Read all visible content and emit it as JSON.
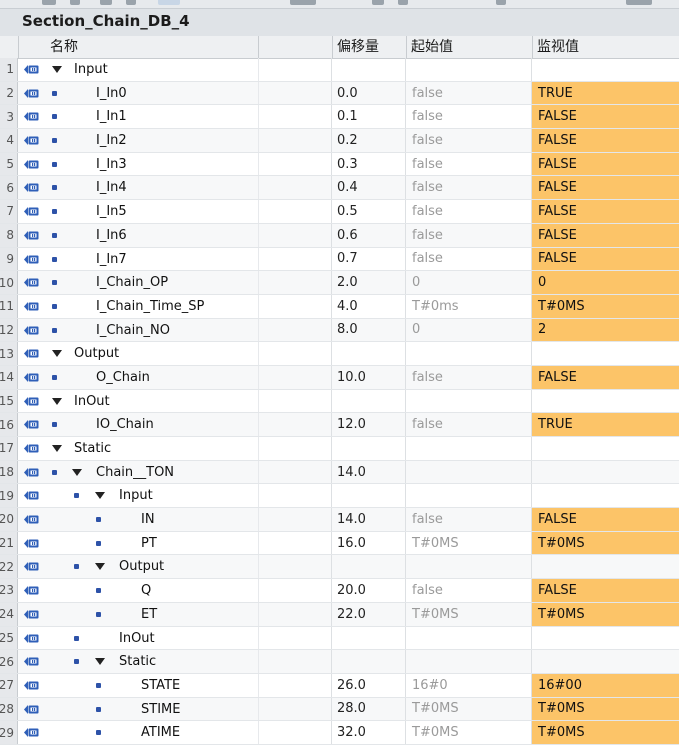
{
  "block_title": "Section_Chain_DB_4",
  "columns": {
    "name": "名称",
    "offset": "偏移量",
    "start": "起始值",
    "monitor": "监视值"
  },
  "rows": [
    {
      "num": "1",
      "level": 0,
      "caret": true,
      "bullet": false,
      "name": "Input",
      "offset": "",
      "start": "",
      "monitor": ""
    },
    {
      "num": "2",
      "level": 1,
      "caret": false,
      "bullet": true,
      "name": "I_In0",
      "offset": "0.0",
      "start": "false",
      "monitor": "TRUE"
    },
    {
      "num": "3",
      "level": 1,
      "caret": false,
      "bullet": true,
      "name": "I_In1",
      "offset": "0.1",
      "start": "false",
      "monitor": "FALSE"
    },
    {
      "num": "4",
      "level": 1,
      "caret": false,
      "bullet": true,
      "name": "I_In2",
      "offset": "0.2",
      "start": "false",
      "monitor": "FALSE"
    },
    {
      "num": "5",
      "level": 1,
      "caret": false,
      "bullet": true,
      "name": "I_In3",
      "offset": "0.3",
      "start": "false",
      "monitor": "FALSE"
    },
    {
      "num": "6",
      "level": 1,
      "caret": false,
      "bullet": true,
      "name": "I_In4",
      "offset": "0.4",
      "start": "false",
      "monitor": "FALSE"
    },
    {
      "num": "7",
      "level": 1,
      "caret": false,
      "bullet": true,
      "name": "I_In5",
      "offset": "0.5",
      "start": "false",
      "monitor": "FALSE"
    },
    {
      "num": "8",
      "level": 1,
      "caret": false,
      "bullet": true,
      "name": "I_In6",
      "offset": "0.6",
      "start": "false",
      "monitor": "FALSE"
    },
    {
      "num": "9",
      "level": 1,
      "caret": false,
      "bullet": true,
      "name": "I_In7",
      "offset": "0.7",
      "start": "false",
      "monitor": "FALSE"
    },
    {
      "num": "10",
      "level": 1,
      "caret": false,
      "bullet": true,
      "name": "I_Chain_OP",
      "offset": "2.0",
      "start": "0",
      "monitor": "0"
    },
    {
      "num": "11",
      "level": 1,
      "caret": false,
      "bullet": true,
      "name": "I_Chain_Time_SP",
      "offset": "4.0",
      "start": "T#0ms",
      "monitor": "T#0MS"
    },
    {
      "num": "12",
      "level": 1,
      "caret": false,
      "bullet": true,
      "name": "I_Chain_NO",
      "offset": "8.0",
      "start": "0",
      "monitor": "2"
    },
    {
      "num": "13",
      "level": 0,
      "caret": true,
      "bullet": false,
      "name": "Output",
      "offset": "",
      "start": "",
      "monitor": ""
    },
    {
      "num": "14",
      "level": 1,
      "caret": false,
      "bullet": true,
      "name": "O_Chain",
      "offset": "10.0",
      "start": "false",
      "monitor": "FALSE"
    },
    {
      "num": "15",
      "level": 0,
      "caret": true,
      "bullet": false,
      "name": "InOut",
      "offset": "",
      "start": "",
      "monitor": ""
    },
    {
      "num": "16",
      "level": 1,
      "caret": false,
      "bullet": true,
      "name": "IO_Chain",
      "offset": "12.0",
      "start": "false",
      "monitor": "TRUE"
    },
    {
      "num": "17",
      "level": 0,
      "caret": true,
      "bullet": false,
      "name": "Static",
      "offset": "",
      "start": "",
      "monitor": ""
    },
    {
      "num": "18",
      "level": 1,
      "caret": true,
      "bullet": true,
      "name": "Chain__TON",
      "offset": "14.0",
      "start": "",
      "monitor": ""
    },
    {
      "num": "19",
      "level": 2,
      "caret": true,
      "bullet": true,
      "name": "Input",
      "offset": "",
      "start": "",
      "monitor": ""
    },
    {
      "num": "20",
      "level": 3,
      "caret": false,
      "bullet": true,
      "name": "IN",
      "offset": "14.0",
      "start": "false",
      "monitor": "FALSE"
    },
    {
      "num": "21",
      "level": 3,
      "caret": false,
      "bullet": true,
      "name": "PT",
      "offset": "16.0",
      "start": "T#0MS",
      "monitor": "T#0MS"
    },
    {
      "num": "22",
      "level": 2,
      "caret": true,
      "bullet": true,
      "name": "Output",
      "offset": "",
      "start": "",
      "monitor": ""
    },
    {
      "num": "23",
      "level": 3,
      "caret": false,
      "bullet": true,
      "name": "Q",
      "offset": "20.0",
      "start": "false",
      "monitor": "FALSE"
    },
    {
      "num": "24",
      "level": 3,
      "caret": false,
      "bullet": true,
      "name": "ET",
      "offset": "22.0",
      "start": "T#0MS",
      "monitor": "T#0MS"
    },
    {
      "num": "25",
      "level": 2,
      "caret": false,
      "bullet": true,
      "name": "InOut",
      "offset": "",
      "start": "",
      "monitor": ""
    },
    {
      "num": "26",
      "level": 2,
      "caret": true,
      "bullet": true,
      "name": "Static",
      "offset": "",
      "start": "",
      "monitor": ""
    },
    {
      "num": "27",
      "level": 3,
      "caret": false,
      "bullet": true,
      "name": "STATE",
      "offset": "26.0",
      "start": "16#0",
      "monitor": "16#00"
    },
    {
      "num": "28",
      "level": 3,
      "caret": false,
      "bullet": true,
      "name": "STIME",
      "offset": "28.0",
      "start": "T#0MS",
      "monitor": "T#0MS"
    },
    {
      "num": "29",
      "level": 3,
      "caret": false,
      "bullet": true,
      "name": "ATIME",
      "offset": "32.0",
      "start": "T#0MS",
      "monitor": "T#0MS"
    }
  ],
  "colors": {
    "monitor_highlight": "#fcc468",
    "bullet": "#2d52a8",
    "iface_icon": "#2f5fb8"
  },
  "icons": {
    "interface": "db-interface-icon",
    "bullet": "member-bullet-icon",
    "expand": "expand-caret-icon"
  }
}
